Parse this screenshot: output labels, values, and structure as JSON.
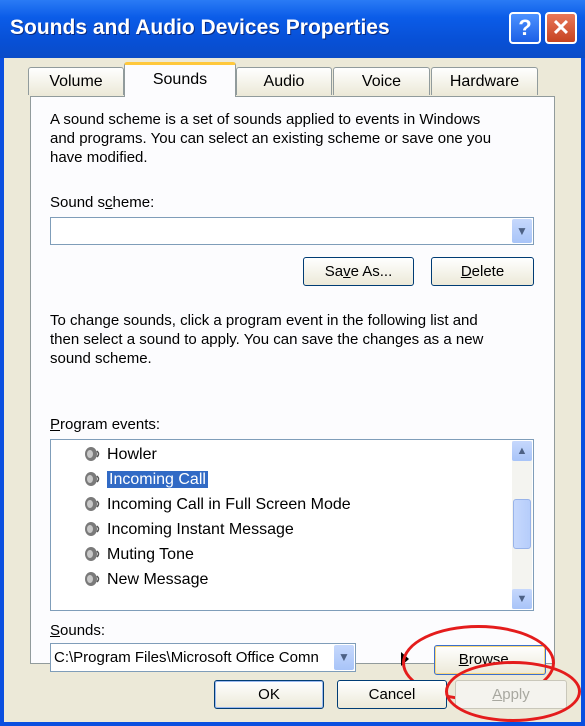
{
  "window": {
    "title": "Sounds and Audio Devices Properties",
    "help_glyph": "?",
    "close_glyph": "✕"
  },
  "tabs": [
    {
      "label": "Volume"
    },
    {
      "label": "Sounds",
      "active": true
    },
    {
      "label": "Audio"
    },
    {
      "label": "Voice"
    },
    {
      "label": "Hardware"
    }
  ],
  "intro_text_lines": [
    "A sound scheme is a set of sounds applied to events in Windows",
    "and programs. You can select an existing scheme or save one you",
    "have modified."
  ],
  "scheme": {
    "label_pre": "Sound s",
    "label_u": "c",
    "label_post": "heme:",
    "value": ""
  },
  "scheme_buttons": {
    "save_as_pre": "Sa",
    "save_as_u": "v",
    "save_as_post": "e As...",
    "delete_u": "D",
    "delete_post": "elete"
  },
  "events_text_lines": [
    "To change sounds, click a program event in the following list and",
    "then select a sound to apply. You can save the changes as a new",
    "sound scheme."
  ],
  "events": {
    "label_u": "P",
    "label_post": "rogram events:",
    "items": [
      "Howler",
      "Incoming Call",
      "Incoming Call in Full Screen Mode",
      "Incoming Instant Message",
      "Muting Tone",
      "New Message"
    ],
    "selected": "Incoming Call"
  },
  "sounds": {
    "label_u": "S",
    "label_post": "ounds:",
    "value": "C:\\Program Files\\Microsoft Office Comn",
    "browse_u": "B",
    "browse_post": "rowse..."
  },
  "footer": {
    "ok": "OK",
    "cancel": "Cancel",
    "apply_u": "A",
    "apply_post": "pply",
    "apply_enabled": false
  },
  "colors": {
    "title_bar": "#0a4fe0",
    "dialog_bg": "#ece9d8",
    "selection": "#316ac5",
    "annotation_circle": "#e41c1c"
  }
}
